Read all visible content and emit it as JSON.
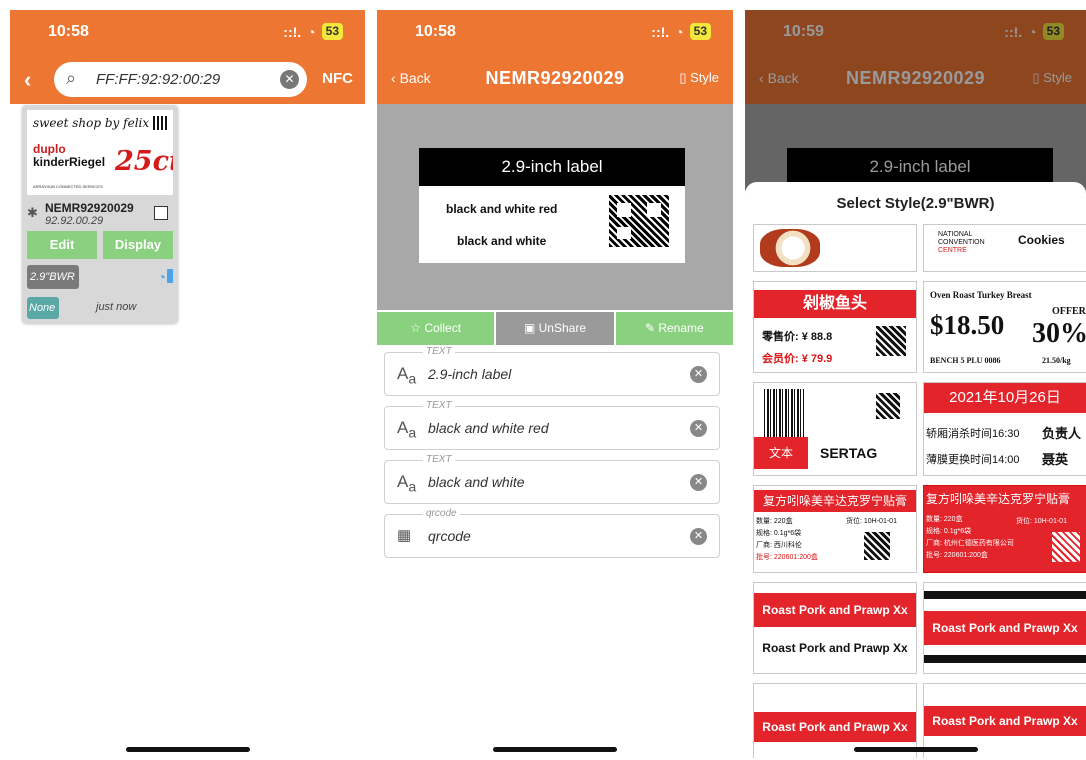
{
  "status": {
    "time_1": "10:58",
    "time_2": "10:58",
    "time_3": "10:59",
    "signal": "::!.",
    "wifi": "◎",
    "battery": "53"
  },
  "screen1": {
    "search_value": "FF:FF:92:92:00:29",
    "nfc_label": "NFC",
    "card": {
      "thumb_shop": "sweet shop by felix",
      "thumb_brand1": "duplo",
      "thumb_brand2": "kinderRiegel",
      "thumb_price": "25ct",
      "thumb_foot": "ARRAYHUB CONNECTED SERVICES",
      "device_name": "NEMR92920029",
      "device_addr": "92.92.00.29",
      "edit_label": "Edit",
      "display_label": "Display",
      "tag_type": "2.9\"BWR",
      "tag_none": "None",
      "last_seen": "just now"
    }
  },
  "screen2": {
    "back_label": "Back",
    "title": "NEMR92920029",
    "style_label": "Style",
    "label_preview": {
      "header": "2.9-inch label",
      "line1": "black and white red",
      "line2": "black and white"
    },
    "actions": {
      "collect": "Collect",
      "unshare": "UnShare",
      "rename": "Rename"
    },
    "fields": [
      {
        "kind": "TEXT",
        "value": "2.9-inch label"
      },
      {
        "kind": "TEXT",
        "value": "black and white red"
      },
      {
        "kind": "TEXT",
        "value": "black and white"
      },
      {
        "kind": "qrcode",
        "value": "qrcode"
      }
    ]
  },
  "screen3": {
    "back_label": "Back",
    "title": "NEMR92920029",
    "style_label": "Style",
    "bg_label": "2.9-inch label",
    "sheet_title": "Select Style(2.9\"BWR)",
    "tiles": {
      "t2_line1": "NATIONAL",
      "t2_line2": "CONVENTION",
      "t2_line3": "CENTRE",
      "t2_cookies": "Cookies",
      "t3_title": "剁椒鱼头",
      "t3_price1": "零售价: ¥ 88.8",
      "t3_price2": "会员价: ¥ 79.9",
      "t4_title": "Oven Roast Turkey Breast",
      "t4_price": "$18.50",
      "t4_offer": "OFFER",
      "t4_pct": "30%",
      "t4_off": "OFF",
      "t4_bench": "BENCH 5   PLU 0086",
      "t4_kg": "21.50/kg",
      "t5_btn": "文本",
      "t5_brand": "SERTAG",
      "t6_date": "2021年10月26日",
      "t6_l1": "轿厢消杀时间16:30",
      "t6_l1b": "负责人",
      "t6_l2": "薄膜更换时间14:00",
      "t6_l2b": "聂英",
      "t7_title": "复方吲哚美辛达克罗宁贴膏",
      "t7_l1": "数量: 220盒",
      "t7_l1b": "货位: 10H-01-01",
      "t7_l2": "规格: 0.1g*6袋",
      "t7_l3": "厂商: 西川科伦",
      "t7_l4": "批号: 220601:200盒",
      "t8_title": "复方吲哚美辛达克罗宁贴膏",
      "t8_l1": "数量: 220盒",
      "t8_l1b": "货位: 10H-01-01",
      "t8_l2": "规格: 0.1g*6袋",
      "t8_l3": "厂商: 杭州仁德医药有限公司",
      "t8_l4": "批号: 220601:200盒",
      "t9_top": "Roast Pork and Prawp Xx",
      "t9_bottom": "Roast Pork and Prawp Xx",
      "t10_mid": "Roast Pork and Prawp Xx",
      "t11_mid": "Roast Pork and Prawp Xx",
      "t12_mid": "Roast Pork and Prawp Xx"
    }
  },
  "colors": {
    "accent": "#ec7632",
    "green": "#8ad17f",
    "red": "#e3242b"
  }
}
